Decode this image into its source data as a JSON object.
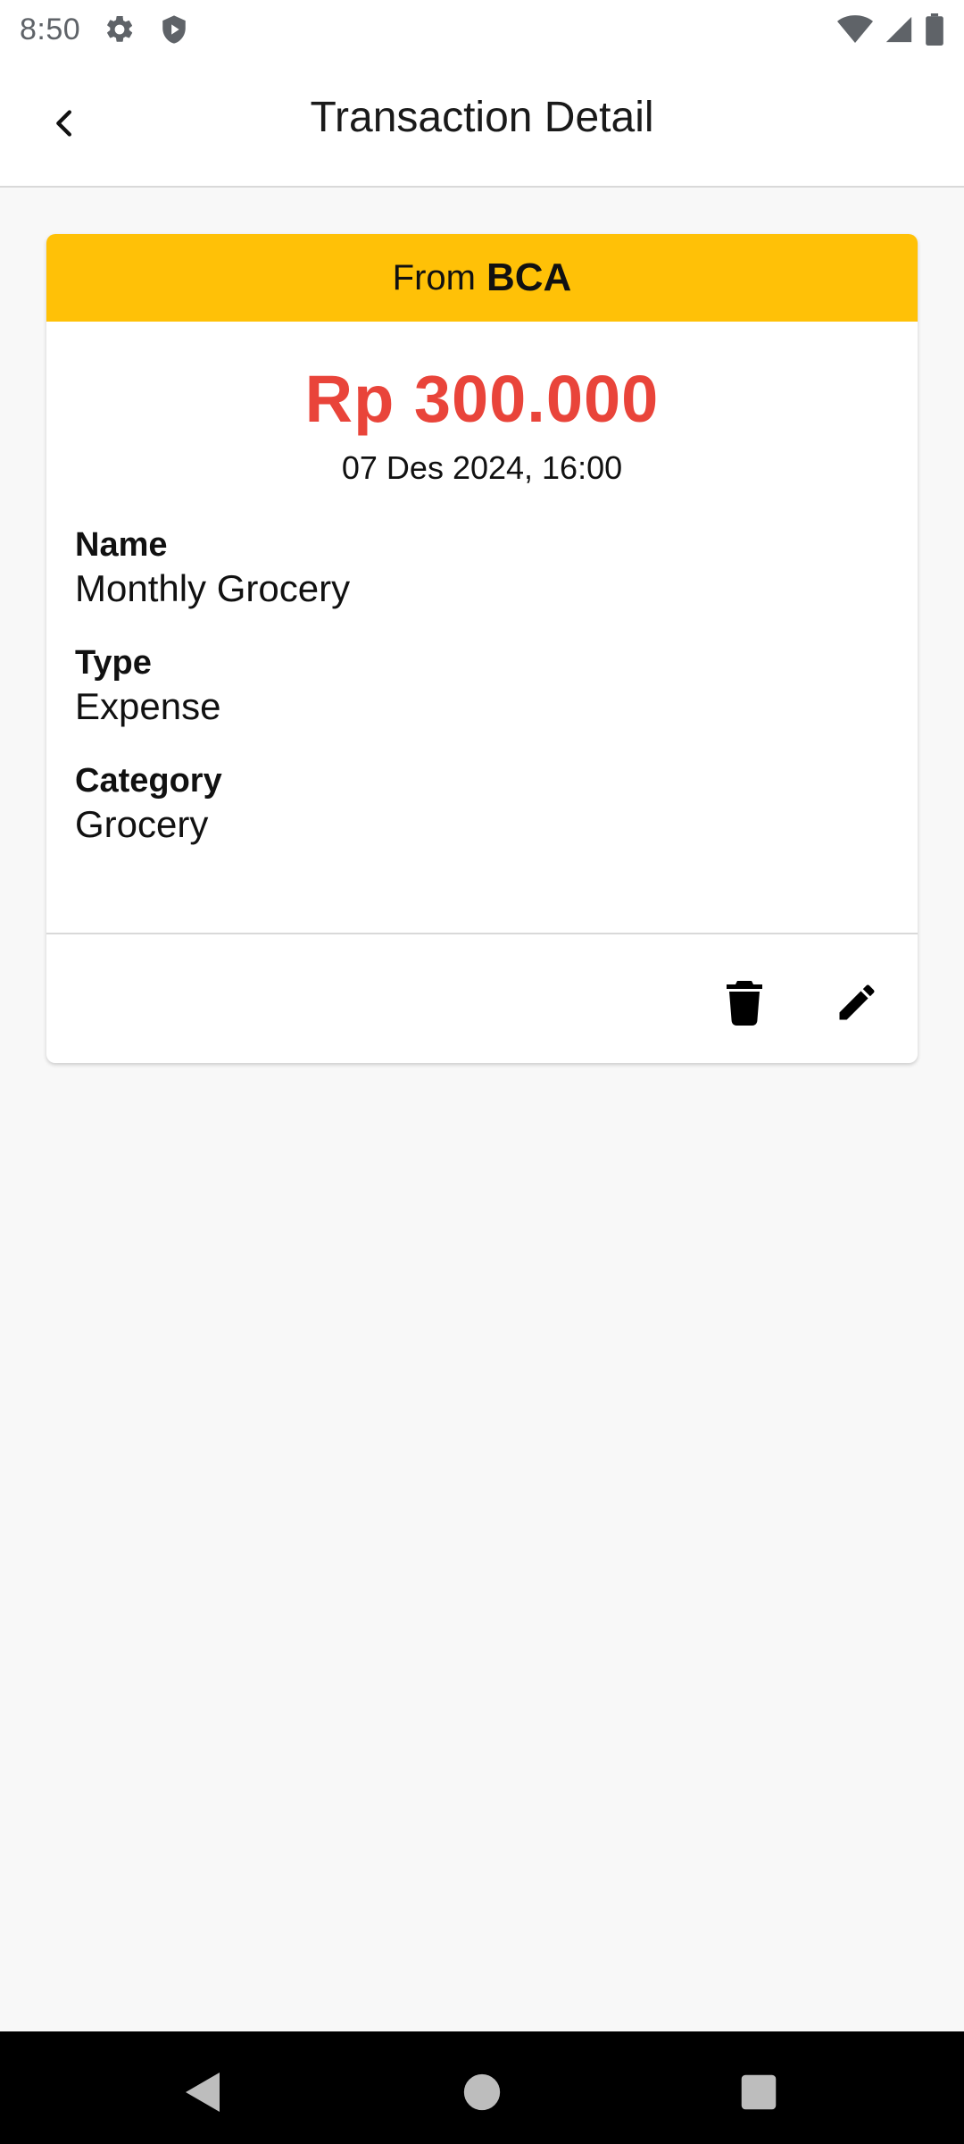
{
  "status_bar": {
    "time": "8:50",
    "icons": [
      "settings-gear-icon",
      "shield-icon",
      "wifi-icon",
      "signal-icon",
      "battery-icon"
    ]
  },
  "app_bar": {
    "title": "Transaction Detail",
    "back_icon": "chevron-left-icon"
  },
  "transaction": {
    "header_prefix": "From",
    "account": "BCA",
    "amount": "Rp 300.000",
    "datetime": "07 Des 2024, 16:00",
    "fields": [
      {
        "label": "Name",
        "value": "Monthly Grocery"
      },
      {
        "label": "Type",
        "value": "Expense"
      },
      {
        "label": "Category",
        "value": "Grocery"
      }
    ],
    "actions": [
      "delete-icon",
      "edit-pencil-icon"
    ]
  },
  "colors": {
    "header_bg": "#ffc107",
    "amount": "#e9443a",
    "page_bg": "#f8f8f8",
    "nav_bar": "#000000"
  },
  "nav_bar": {
    "buttons": [
      "back-triangle-icon",
      "home-circle-icon",
      "recents-square-icon"
    ]
  }
}
